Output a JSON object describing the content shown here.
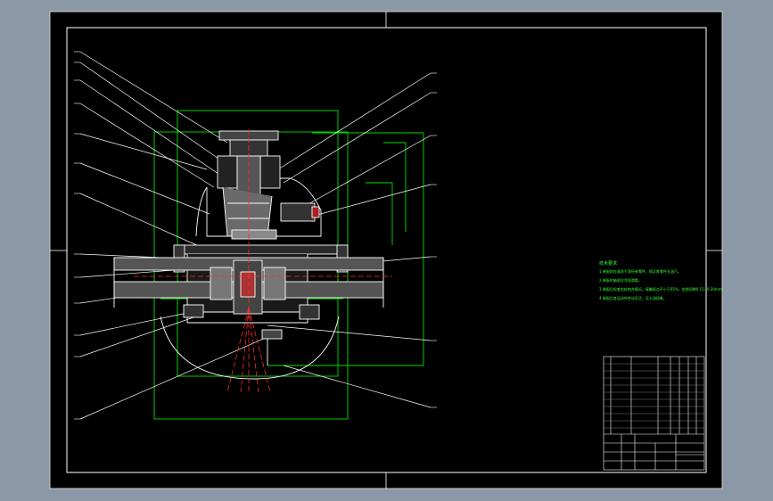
{
  "notes": {
    "title": "技术要求",
    "lines": [
      "1.装配前应清洗干净所有零件，保证各零件无油污。",
      "2.装配时轴承应涂润滑脂。",
      "3.装配后检查齿轮啮合情况，接触斑点不小于65%，齿侧间隙0.15~0.30mm。",
      "4.装配后各运动件转动灵活，无卡滞现象。"
    ]
  },
  "colors": {
    "frame": "#ffffff",
    "drawing_line": "#ffffff",
    "dimension": "#00e000",
    "center_line": "#ff2a2a",
    "note_text": "#3cff3c",
    "sheet_bg": "#000000",
    "canvas_bg": "#8b98a8"
  }
}
